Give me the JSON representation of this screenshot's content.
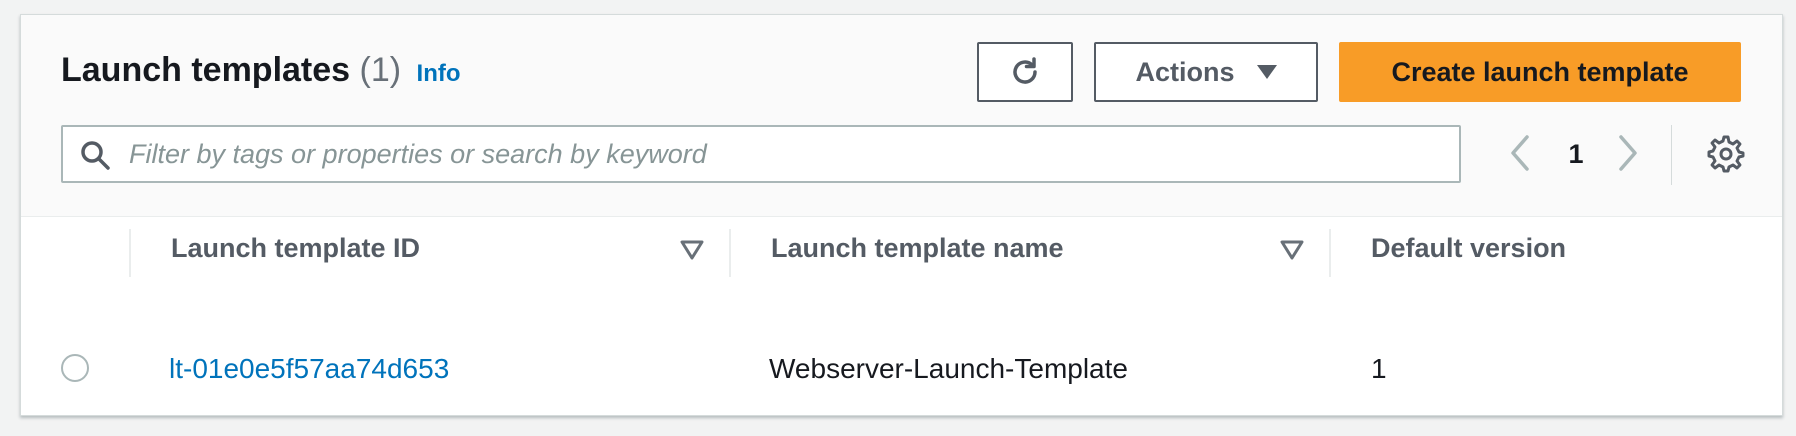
{
  "header": {
    "title": "Launch templates",
    "count": "(1)",
    "info_link": "Info"
  },
  "toolbar": {
    "refresh_icon": "refresh-icon",
    "actions_label": "Actions",
    "create_label": "Create launch template"
  },
  "search": {
    "placeholder": "Filter by tags or properties or search by keyword",
    "value": ""
  },
  "pagination": {
    "current_page": "1"
  },
  "table": {
    "columns": [
      {
        "label": "Launch template ID"
      },
      {
        "label": "Launch template name"
      },
      {
        "label": "Default version"
      }
    ],
    "rows": [
      {
        "id": "lt-01e0e5f57aa74d653",
        "name": "Webserver-Launch-Template",
        "default_version": "1",
        "selected": false
      }
    ]
  },
  "colors": {
    "primary": "#f89c27",
    "link": "#0073bb",
    "text": "#16191f",
    "secondary_text": "#545b64"
  }
}
